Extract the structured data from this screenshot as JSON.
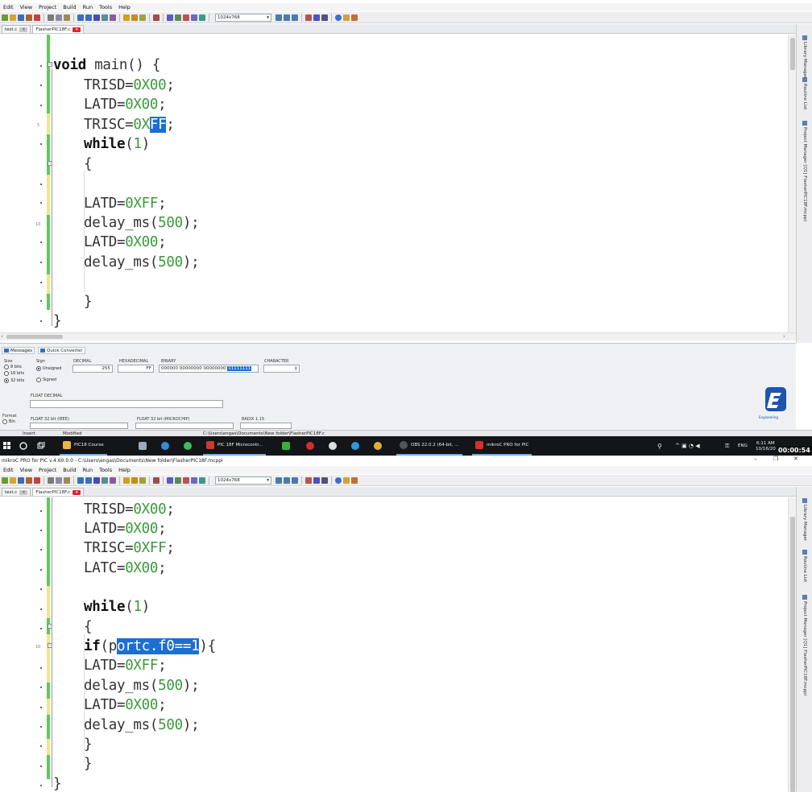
{
  "menu": [
    "Edit",
    "View",
    "Project",
    "Build",
    "Run",
    "Tools",
    "Help"
  ],
  "toolbar": {
    "resolution": "1024x768"
  },
  "top": {
    "tabs": [
      {
        "label": "test.c",
        "active": false
      },
      {
        "label": "FlasherPIC18F.c",
        "active": true
      }
    ],
    "line_number": "5",
    "line_number_b": "10",
    "code": {
      "l1_kw": "void",
      "l1_rest": " main() {",
      "l2_a": "TRISD=",
      "l2_b": "0X00",
      "l2_c": ";",
      "l3_a": "LATD=",
      "l3_b": "0X00",
      "l3_c": ";",
      "l4_a": "TRISC=",
      "l4_b": "0X",
      "l4_sel": "FF",
      "l4_c": ";",
      "l5_kw": "while",
      "l5_a": "(",
      "l5_b": "1",
      "l5_c": ")",
      "l6": "{",
      "l7_a": "LATD=",
      "l7_b": "0XFF",
      "l7_c": ";",
      "l8_a": "delay_ms(",
      "l8_b": "500",
      "l8_c": ");",
      "l9_a": "LATD=",
      "l9_b": "0X00",
      "l9_c": ";",
      "l10_a": "delay_ms(",
      "l10_b": "500",
      "l10_c": ");",
      "l11": "}",
      "l12": "}"
    }
  },
  "right_panel": {
    "library_manager": "Library Manager",
    "routine_list": "Routine List",
    "project_manager": "Project Manager [Q1] FlasherPIC18F.mcppi"
  },
  "bottom_panel": {
    "tabs": [
      "Messages",
      "Quick Converter"
    ],
    "size_label": "Size",
    "sizes": [
      "8 bits",
      "16 bits",
      "32 bits"
    ],
    "sign_label": "Sign",
    "signs": [
      "Unsigned",
      "Signed"
    ],
    "decimal_label": "DECIMAL",
    "decimal_value": "255",
    "hex_label": "HEXADECIMAL",
    "hex_value": "FF",
    "binary_label": "BINARY",
    "binary_value": "000000 00000000 00000000 ",
    "binary_sel": "11111111",
    "char_label": "CHARACTER",
    "char_value": "ÿ",
    "float_decimal_label": "FLOAT DECIMAL",
    "format_label": "Format",
    "format_bin": "Bin",
    "float_ieee_label": "FLOAT 32 bit (IEEE)",
    "float_microchip_label": "FLOAT 32 bit (MICROCHIP)",
    "radix_label": "RADIX 1.15",
    "logo_caption": "Engineering"
  },
  "status": {
    "insert": "Insert",
    "modified": "Modified",
    "path": "C:\\Users\\engas\\Documents\\New folder\\FlasherPIC18F.c"
  },
  "taskbar": {
    "items": [
      {
        "label": "PIC18 Course",
        "color": "#e8b44a"
      },
      {
        "label": "PIC 18F Microcontr...",
        "color": "#c7402c"
      },
      {
        "label": "OBS 22.0.2 (64-bit, ...",
        "color": "#444"
      },
      {
        "label": "mikroC PRO for PIC",
        "color": "#d8302c"
      }
    ],
    "lang": "ENG",
    "time": "6:11 AM",
    "date": "10/16/20",
    "timer": "00:00:54"
  },
  "bottom_window": {
    "title": "mikroC PRO for PIC v.4.60.0.0 - C:\\Users\\engas\\Documents\\New folder\\FlasherPIC18F.mcppi",
    "line_number": "10",
    "code": {
      "l1_a": "TRISD=",
      "l1_b": "0X00",
      "l1_c": ";",
      "l2_a": "LATD=",
      "l2_b": "0X00",
      "l2_c": ";",
      "l3_a": "TRISC=",
      "l3_b": "0XFF",
      "l3_c": ";",
      "l4_a": "LATC=",
      "l4_b": "0X00",
      "l4_c": ";",
      "l5_kw": "while",
      "l5_a": "(",
      "l5_b": "1",
      "l5_c": ")",
      "l6": "{",
      "l7_kw": "if",
      "l7_a": "(p",
      "l7_sel": "ortc.f0==1",
      "l7_c": "){",
      "l8_a": "LATD=",
      "l8_b": "0XFF",
      "l8_c": ";",
      "l9_a": "delay_ms(",
      "l9_b": "500",
      "l9_c": ");",
      "l10_a": "LATD=",
      "l10_b": "0X00",
      "l10_c": ";",
      "l11_a": "delay_ms(",
      "l11_b": "500",
      "l11_c": ");",
      "l12": "}",
      "l13": "}",
      "l14": "}"
    }
  }
}
